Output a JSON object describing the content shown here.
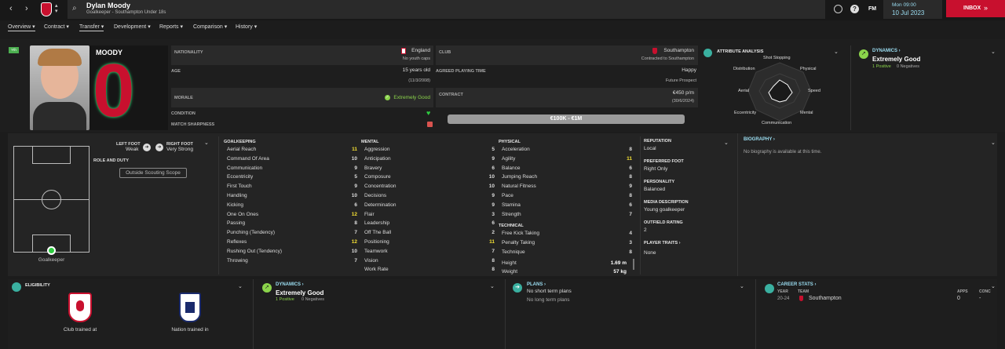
{
  "header": {
    "name": "Dylan Moody",
    "subtitle": "Goalkeeper - Southampton Under 18s",
    "date_day": "Mon 09:00",
    "date": "10 Jul 2023",
    "inbox": "INBOX",
    "fm": "FM"
  },
  "tabs": [
    {
      "label": "Overview"
    },
    {
      "label": "Contract"
    },
    {
      "label": "Transfer"
    },
    {
      "label": "Development"
    },
    {
      "label": "Reports"
    },
    {
      "label": "Comparison"
    },
    {
      "label": "History"
    }
  ],
  "profile": {
    "badge": "Yth",
    "surname": "MOODY",
    "number": "0"
  },
  "info": {
    "nationality_label": "NATIONALITY",
    "nationality": "England",
    "caps": "No youth caps",
    "age_label": "AGE",
    "age": "15 years old",
    "dob": "(11/3/2008)",
    "morale_label": "MORALE",
    "morale": "Extremely Good",
    "condition_label": "CONDITION",
    "sharpness_label": "MATCH SHARPNESS",
    "club_label": "CLUB",
    "club": "Southampton",
    "club_sub": "Contracted to Southampton",
    "apt_label": "AGREED PLAYING TIME",
    "apt": "Happy",
    "apt_sub": "Future Prospect",
    "contract_label": "CONTRACT",
    "wage": "€450 p/m",
    "contract_end": "(30/6/2024)",
    "value": "€100K - €1M"
  },
  "attr_analysis": {
    "title": "ATTRIBUTE ANALYSIS",
    "axes": [
      "Shot Stopping",
      "Physical",
      "Speed",
      "Mental",
      "Communication",
      "Eccentricity",
      "Aerial",
      "Distribution"
    ]
  },
  "dynamics": {
    "title": "DYNAMICS",
    "value": "Extremely Good",
    "positive": "1 Positive",
    "negative": "0 Negatives"
  },
  "pitch": {
    "position": "Goalkeeper",
    "left_foot_label": "LEFT FOOT",
    "left_foot": "Weak",
    "right_foot_label": "RIGHT FOOT",
    "right_foot": "Very Strong",
    "role_label": "ROLE AND DUTY",
    "scouting": "Outside Scouting Scope"
  },
  "goalkeeping": {
    "title": "GOALKEEPING",
    "rows": [
      [
        "Aerial Reach",
        "11"
      ],
      [
        "Command Of Area",
        "10"
      ],
      [
        "Communication",
        "9"
      ],
      [
        "Eccentricity",
        "5"
      ],
      [
        "First Touch",
        "9"
      ],
      [
        "Handling",
        "10"
      ],
      [
        "Kicking",
        "6"
      ],
      [
        "One On Ones",
        "12"
      ],
      [
        "Passing",
        "8"
      ],
      [
        "Punching (Tendency)",
        "7"
      ],
      [
        "Reflexes",
        "12"
      ],
      [
        "Rushing Out (Tendency)",
        "10"
      ],
      [
        "Throwing",
        "7"
      ]
    ]
  },
  "mental": {
    "title": "MENTAL",
    "rows": [
      [
        "Aggression",
        "5"
      ],
      [
        "Anticipation",
        "9"
      ],
      [
        "Bravery",
        "6"
      ],
      [
        "Composure",
        "10"
      ],
      [
        "Concentration",
        "10"
      ],
      [
        "Decisions",
        "9"
      ],
      [
        "Determination",
        "9"
      ],
      [
        "Flair",
        "3"
      ],
      [
        "Leadership",
        "6"
      ],
      [
        "Off The Ball",
        "2"
      ],
      [
        "Positioning",
        "11"
      ],
      [
        "Teamwork",
        "7"
      ],
      [
        "Vision",
        "8"
      ],
      [
        "Work Rate",
        "8"
      ]
    ]
  },
  "physical": {
    "title": "PHYSICAL",
    "rows": [
      [
        "Acceleration",
        "8"
      ],
      [
        "Agility",
        "11"
      ],
      [
        "Balance",
        "6"
      ],
      [
        "Jumping Reach",
        "8"
      ],
      [
        "Natural Fitness",
        "9"
      ],
      [
        "Pace",
        "8"
      ],
      [
        "Stamina",
        "6"
      ],
      [
        "Strength",
        "7"
      ]
    ]
  },
  "technical": {
    "title": "TECHNICAL",
    "rows": [
      [
        "Free Kick Taking",
        "4"
      ],
      [
        "Penalty Taking",
        "3"
      ],
      [
        "Technique",
        "8"
      ]
    ],
    "height_label": "Height",
    "height": "1.69 m",
    "weight_label": "Weight",
    "weight": "57 kg"
  },
  "details": {
    "reputation_label": "REPUTATION",
    "reputation": "Local",
    "pref_foot_label": "PREFERRED FOOT",
    "pref_foot": "Right Only",
    "personality_label": "PERSONALITY",
    "personality": "Balanced",
    "media_label": "MEDIA DESCRIPTION",
    "media": "Young goalkeeper",
    "outfield_label": "OUTFIELD RATING",
    "outfield": "2",
    "traits_label": "PLAYER TRAITS",
    "traits": "None"
  },
  "biography": {
    "title": "BIOGRAPHY",
    "text": "No biography is available at this time."
  },
  "eligibility": {
    "title": "ELIGIBILITY",
    "club": "Club trained at",
    "nation": "Nation trained in"
  },
  "plans": {
    "title": "PLANS",
    "short": "No short term plans",
    "long": "No long term plans"
  },
  "career": {
    "title": "CAREER STATS",
    "year_label": "YEAR",
    "team_label": "TEAM",
    "apps_label": "APPS",
    "conc_label": "CONC",
    "year": "20-24",
    "team": "Southampton",
    "apps": "0",
    "conc": "-"
  },
  "colors": {
    "accent": "#c8102e",
    "green": "#8bd44b",
    "yellow": "#f5e033",
    "teal": "#3ab0a0"
  }
}
